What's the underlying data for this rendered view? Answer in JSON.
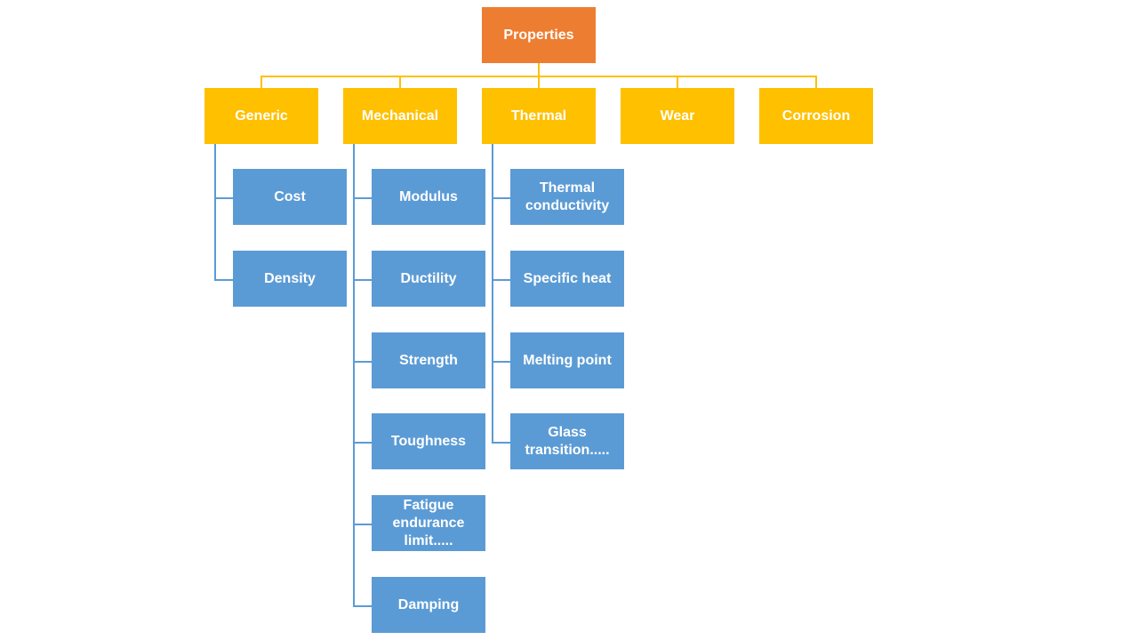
{
  "diagram": {
    "type": "hierarchy",
    "colors": {
      "root": "#ED7D31",
      "category": "#FFC000",
      "leaf": "#5B9BD5",
      "category_connector": "#FFC000",
      "leaf_connector": "#5B9BD5",
      "text": "#FFFFFF"
    },
    "root": {
      "label": "Properties"
    },
    "categories": [
      {
        "label": "Generic",
        "children": [
          "Cost",
          "Density"
        ]
      },
      {
        "label": "Mechanical",
        "children": [
          "Modulus",
          "Ductility",
          "Strength",
          "Toughness",
          "Fatigue\nendurance\nlimit.....",
          "Damping"
        ]
      },
      {
        "label": "Thermal",
        "children": [
          "Thermal\nconductivity",
          "Specific heat",
          "Melting point",
          "Glass\ntransition....."
        ]
      },
      {
        "label": "Wear",
        "children": []
      },
      {
        "label": "Corrosion",
        "children": []
      }
    ]
  }
}
